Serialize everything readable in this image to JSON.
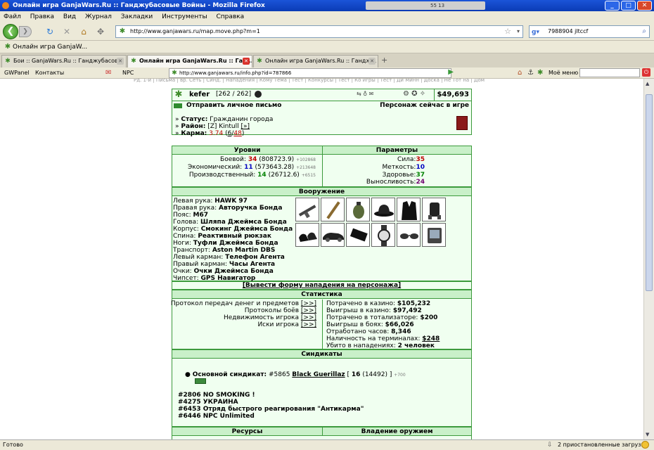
{
  "window": {
    "title": "Онлайн игра GanjaWars.Ru :: Ганджубасовые Войны - Mozilla Firefox",
    "media_time": "55 13"
  },
  "menu": [
    "Файл",
    "Правка",
    "Вид",
    "Журнал",
    "Закладки",
    "Инструменты",
    "Справка"
  ],
  "nav": {
    "url": "http://www.ganjawars.ru/map.move.php?m=1",
    "search": "7988904 jltccf"
  },
  "bookmark": "Онлайн игра GanjaW...",
  "tabs": [
    {
      "label": "Бои :: GanjaWars.Ru :: Ганджубасов...",
      "active": false
    },
    {
      "label": "Онлайн игра GanjaWars.Ru :: Ган...",
      "active": true
    },
    {
      "label": "Онлайн игра GanjaWars.Ru :: Гандж...",
      "active": false
    }
  ],
  "gwbar": {
    "panel": "GWPanel",
    "contacts": "Контакты",
    "npc": "NPC",
    "url": "http://www.ganjawars.ru/info.php?id=787866",
    "menu": "Моё меню"
  },
  "topnav": "Рд. 1-й | Письма | вр. Сеть | Синд. | Нападения | Кому Тема | Тест | Конкурсы | Тест | Ко игры | Тест | Ди Минн | Доска | Не Тот на | Дом",
  "profile": {
    "name": "kefer",
    "hp": "[262 / 262]",
    "money": "$49,693",
    "send_mail": "Отправить личное письмо",
    "in_game": "Персонаж сейчас в игре",
    "status_label": "Статус:",
    "status_value": "Гражданин города",
    "district_label": "Район:",
    "district_value": "[Z] Kintull",
    "district_link": "[»]",
    "karma_label": "Карма:",
    "karma_value": "3.74",
    "karma_a": "6",
    "karma_b": "48"
  },
  "levels": {
    "title": "Уровни",
    "rows": [
      {
        "label": "Боевой:",
        "level": "34",
        "exp": "(808723.9)",
        "plus": "+102868"
      },
      {
        "label": "Экономический:",
        "level": "11",
        "exp": "(573643.28)",
        "plus": "+213648"
      },
      {
        "label": "Производственный:",
        "level": "14",
        "exp": "(26712.6)",
        "plus": "+6515"
      }
    ]
  },
  "params": {
    "title": "Параметры",
    "rows": [
      {
        "label": "Сила:",
        "value": "35"
      },
      {
        "label": "Меткость:",
        "value": "10"
      },
      {
        "label": "Здоровье:",
        "value": "37"
      },
      {
        "label": "Выносливость:",
        "value": "24"
      }
    ]
  },
  "armament": {
    "title": "Вооружение",
    "rows": [
      {
        "label": "Левая рука:",
        "value": "HAWK 97"
      },
      {
        "label": "Правая рука:",
        "value": "Авторучка Бонда"
      },
      {
        "label": "Пояс:",
        "value": "M67"
      },
      {
        "label": "Голова:",
        "value": "Шляпа Джеймса Бонда"
      },
      {
        "label": "Корпус:",
        "value": "Смокинг Джеймса Бонда"
      },
      {
        "label": "Спина:",
        "value": "Реактивный рюкзак"
      },
      {
        "label": "Ноги:",
        "value": "Туфли Джеймса Бонда"
      },
      {
        "label": "Транспорт:",
        "value": "Aston Martin DBS"
      },
      {
        "label": "Левый карман:",
        "value": "Телефон Агента"
      },
      {
        "label": "Правый карман:",
        "value": "Часы Агента"
      },
      {
        "label": "Очки:",
        "value": "Очки Джеймса Бонда"
      },
      {
        "label": "Чипсет:",
        "value": "GPS Навигатор"
      }
    ]
  },
  "attack_form": "[Вывести форму нападения на персонажа]",
  "stats": {
    "title": "Статистика",
    "links": [
      {
        "label": "Протокол передач денег и предметов",
        "btn": "[>>]"
      },
      {
        "label": "Протоколы боёв",
        "btn": "[>>]"
      },
      {
        "label": "Недвижимость игрока",
        "btn": "[>>]"
      },
      {
        "label": "Иски игрока",
        "btn": "[>>]"
      }
    ],
    "values": [
      {
        "label": "Потрачено в казино:",
        "value": "$105,232"
      },
      {
        "label": "Выигрыш в казино:",
        "value": "$97,492"
      },
      {
        "label": "Потрачено в тотализаторе:",
        "value": "$200"
      },
      {
        "label": "Выигрыш в боях:",
        "value": "$66,026"
      },
      {
        "label": "Отработано часов:",
        "value": "8,346"
      },
      {
        "label": "Наличность на терминалах:",
        "value": "$248"
      },
      {
        "label": "Убито в нападениях:",
        "value": "2 человек"
      }
    ]
  },
  "syndicates": {
    "title": "Синдикаты",
    "main_label": "Основной синдикат:",
    "main_id": "#5865",
    "main_name": "Black Guerillaz",
    "main_level": "16",
    "main_exp": "(14492)",
    "main_plus": "+700",
    "others": [
      "#2806 NO SMOKING !",
      "#4275 УКРАИНА",
      "#6453 Отряд быстрого реагирования \"Антикарма\"",
      "#6446 NPC Unlimited"
    ]
  },
  "bottom": {
    "resources": "Ресурсы",
    "weapons": "Владение оружием"
  },
  "statusbar": {
    "left": "Готово",
    "right": "2 приостановленные загрузки"
  }
}
